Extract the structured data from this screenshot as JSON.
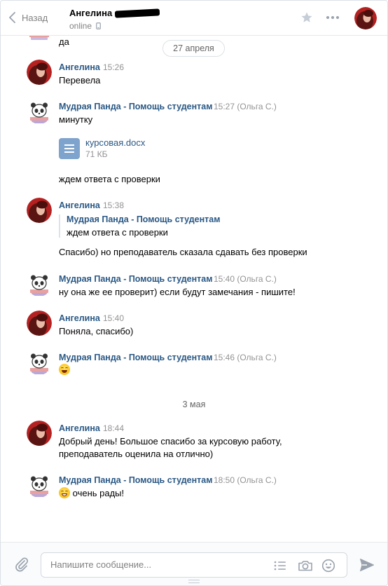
{
  "header": {
    "back_label": "Назад",
    "peer_name": "Ангелина",
    "peer_status": "online",
    "icons": [
      "chevron-left-icon",
      "mobile-icon",
      "star-icon",
      "more-icon"
    ]
  },
  "history": {
    "top_partial_text": "да",
    "date_separators": [
      "27 апреля",
      "3 мая"
    ],
    "messages": [
      {
        "author": "Ангелина",
        "time": "15:26",
        "text": "Перевела"
      },
      {
        "author": "Мудрая Панда - Помощь студентам",
        "time": "15:27 (Ольга С.)",
        "text": "минутку",
        "attachment": {
          "name": "курсовая.docx",
          "size": "71 КБ"
        },
        "text2": "ждем ответа с проверки"
      },
      {
        "author": "Ангелина",
        "time": "15:38",
        "forwarded": {
          "author": "Мудрая Панда - Помощь студентам",
          "text": "ждем ответа с проверки"
        },
        "text": "Спасибо) но преподаватель сказала сдавать без проверки"
      },
      {
        "author": "Мудрая Панда - Помощь студентам",
        "time": "15:40 (Ольга С.)",
        "text": "ну она же ее проверит) если будут замечания - пишите!"
      },
      {
        "author": "Ангелина",
        "time": "15:40",
        "text": "Поняла, спасибо)"
      },
      {
        "author": "Мудрая Панда - Помощь студентам",
        "time": "15:46 (Ольга С.)",
        "emoji": "smiling-face-icon"
      },
      {
        "author": "Ангелина",
        "time": "18:44",
        "text": "Добрый день! Большое спасибо за курсовую работу,",
        "text2": "преподаватель оценила на отлично)"
      },
      {
        "author": "Мудрая Панда - Помощь студентам",
        "time": "18:50 (Ольга С.)",
        "emoji": "grinning-face-icon",
        "text": "очень рады!"
      }
    ]
  },
  "composer": {
    "placeholder": "Напишите сообщение...",
    "icons": [
      "paperclip-icon",
      "template-list-icon",
      "camera-icon",
      "emoji-icon",
      "send-icon"
    ]
  },
  "colors": {
    "link": "#2a5885",
    "muted": "#939393",
    "doc_icon": "#7ea3cc"
  }
}
